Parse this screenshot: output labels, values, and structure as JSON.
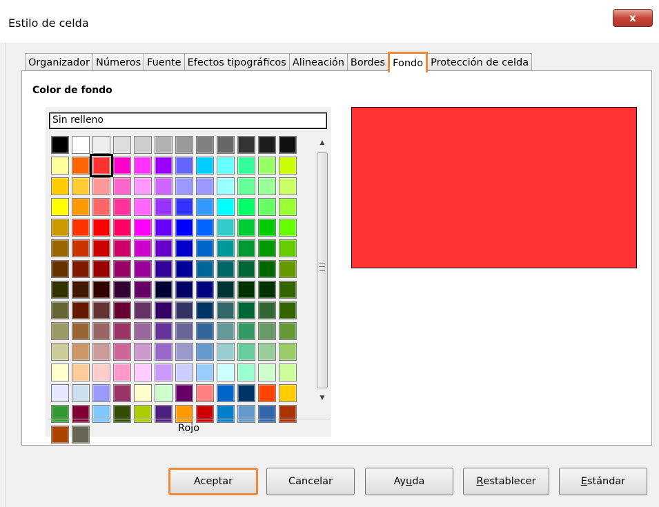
{
  "window": {
    "title": "Estilo de celda",
    "close_symbol": "x"
  },
  "tabs": [
    {
      "label": "Organizador",
      "active": false
    },
    {
      "label": "Números",
      "active": false
    },
    {
      "label": "Fuente",
      "active": false
    },
    {
      "label": "Efectos tipográficos",
      "active": false
    },
    {
      "label": "Alineación",
      "active": false
    },
    {
      "label": "Bordes",
      "active": false
    },
    {
      "label": "Fondo",
      "active": true
    },
    {
      "label": "Protección de celda",
      "active": false
    }
  ],
  "background": {
    "section_title": "Color de fondo",
    "none_option": "Sin relleno",
    "selected_color_name": "Rojo",
    "selected_color_hex": "#ff3333",
    "selected_index": 14,
    "palette": [
      "#000000",
      "#ffffff",
      "#eeeeee",
      "#dddddd",
      "#cccccc",
      "#b2b2b2",
      "#999999",
      "#808080",
      "#666666",
      "#333333",
      "#1c1c1c",
      "#111111",
      "#ffff99",
      "#ff6600",
      "#ff3333",
      "#ff00cc",
      "#ff33ff",
      "#9900ff",
      "#6666ff",
      "#00ccff",
      "#66ffff",
      "#33ff99",
      "#99ff66",
      "#ccff00",
      "#ffcc00",
      "#ffcc33",
      "#ff9999",
      "#ff66cc",
      "#ff99ff",
      "#cc66ff",
      "#9999ff",
      "#9999ff",
      "#99ffff",
      "#66ff99",
      "#99ff99",
      "#ccff66",
      "#ffff00",
      "#ff9900",
      "#ff6666",
      "#ff3399",
      "#ff66ff",
      "#9933ff",
      "#3333ff",
      "#3399ff",
      "#00ffff",
      "#00ff66",
      "#66ff66",
      "#99ff33",
      "#cc9900",
      "#ff3300",
      "#ff0000",
      "#ff0066",
      "#ff00ff",
      "#6600ff",
      "#0000ff",
      "#0066ff",
      "#33cccc",
      "#00cc33",
      "#00cc00",
      "#66ff00",
      "#996600",
      "#cc3300",
      "#cc0000",
      "#cc0066",
      "#cc00cc",
      "#6600cc",
      "#0000cc",
      "#0066cc",
      "#009999",
      "#009933",
      "#009900",
      "#66cc00",
      "#663300",
      "#801900",
      "#990000",
      "#990066",
      "#990099",
      "#330099",
      "#000099",
      "#006699",
      "#006666",
      "#006633",
      "#006600",
      "#669900",
      "#333300",
      "#401900",
      "#330000",
      "#330033",
      "#660066",
      "#000033",
      "#000066",
      "#000080",
      "#003333",
      "#003300",
      "#003300",
      "#336600",
      "#666633",
      "#661900",
      "#663333",
      "#660033",
      "#663366",
      "#330066",
      "#333366",
      "#003366",
      "#336666",
      "#006633",
      "#336633",
      "#336600",
      "#999966",
      "#996633",
      "#996666",
      "#993366",
      "#996699",
      "#663399",
      "#666699",
      "#336699",
      "#669999",
      "#339966",
      "#669966",
      "#669933",
      "#cccc99",
      "#cc9966",
      "#cc9999",
      "#cc6699",
      "#cc99cc",
      "#9966cc",
      "#9999cc",
      "#6699cc",
      "#99cccc",
      "#66cc99",
      "#99cc99",
      "#99cc66",
      "#ffffcc",
      "#ffcc99",
      "#ffcccc",
      "#ff99cc",
      "#ffccff",
      "#cc99ff",
      "#ccccff",
      "#99ccff",
      "#ccffff",
      "#99ffcc",
      "#ccffcc",
      "#ccff99",
      "#e6e6ff",
      "#cce0f0",
      "#9999ff",
      "#993366",
      "#ffffcc",
      "#ccffcc",
      "#660066",
      "#ff8080",
      "#0066cc",
      "#003366",
      "#ff4400",
      "#ffcc00",
      "#339933",
      "#800033",
      "#80c8ff",
      "#334d00",
      "#aacc00",
      "#4d2080",
      "#ff9900",
      "#cc0000",
      "#0080cc",
      "#6699cc",
      "#3366aa",
      "#aa3300",
      "#aa4400",
      "#666655"
    ]
  },
  "buttons": {
    "ok": "Aceptar",
    "cancel": "Cancelar",
    "help_pre": "Ay",
    "help_mn": "u",
    "help_post": "da",
    "reset_mn": "R",
    "reset_post": "establecer",
    "std_mn": "E",
    "std_post": "stándar"
  }
}
